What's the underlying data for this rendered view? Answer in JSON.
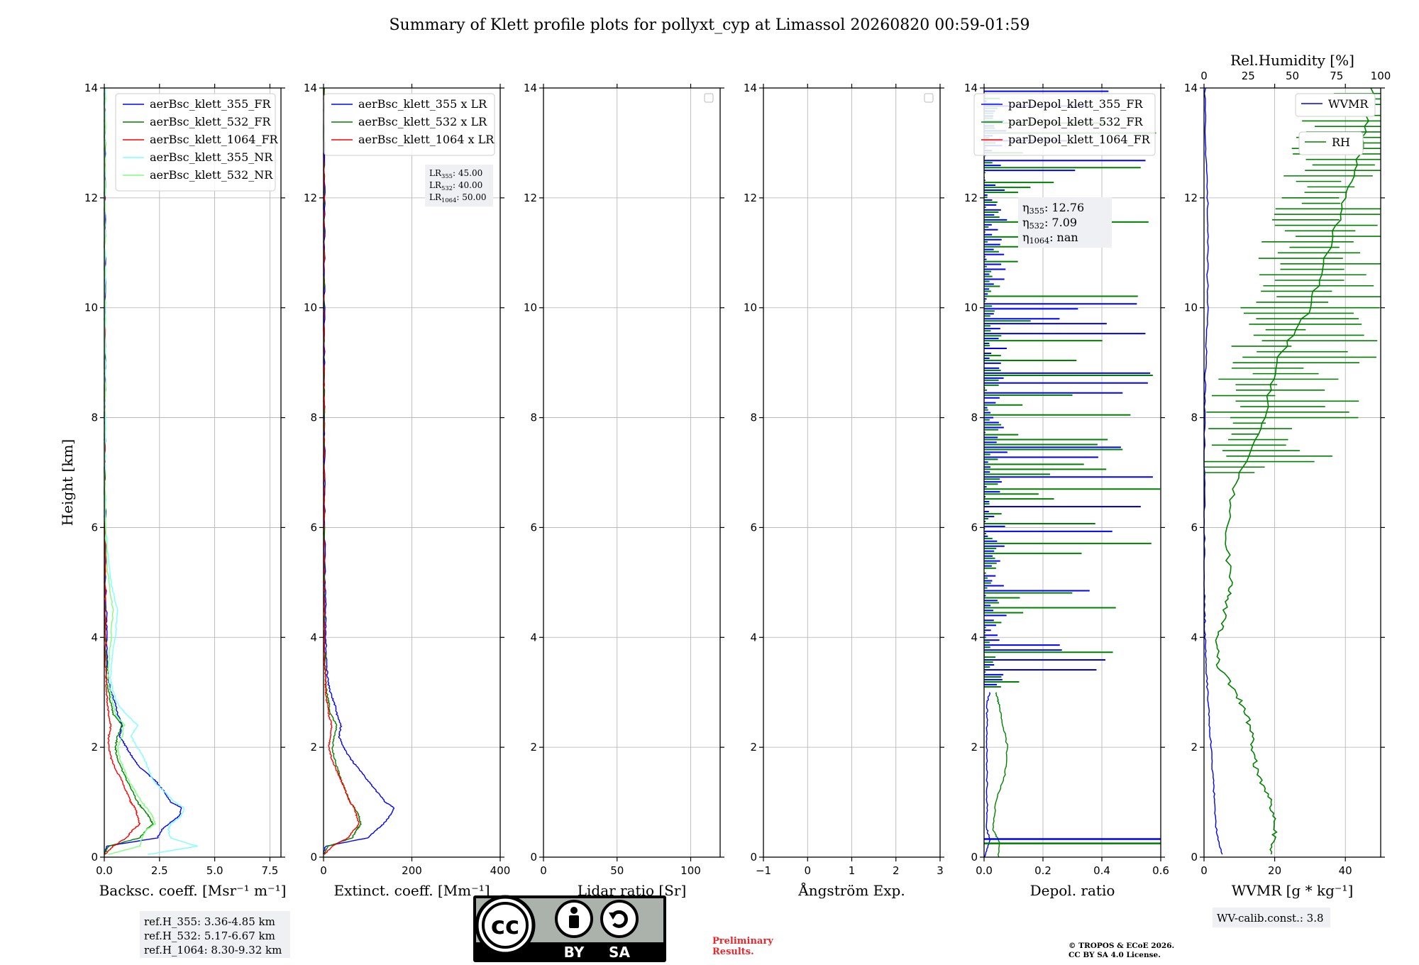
{
  "title": "Summary of Klett profile plots for pollyxt_cyp at Limassol 20260820 00:59-01:59",
  "y_label": "Height [km]",
  "panels": [
    {
      "id": "backscatter",
      "xlabel": "Backsc. coeff. [Msr⁻¹ m⁻¹]",
      "xlim": [
        0,
        8
      ],
      "xticks": [
        0,
        2.5,
        5.0,
        7.5
      ],
      "xtick_labels": [
        "0.0",
        "2.5",
        "5.0",
        "7.5"
      ],
      "legend": [
        "aerBsc_klett_355_FR",
        "aerBsc_klett_532_FR",
        "aerBsc_klett_1064_FR",
        "aerBsc_klett_355_NR",
        "aerBsc_klett_532_NR"
      ],
      "info_box": [
        "ref.H_355: 3.36-4.85 km",
        "ref.H_532: 5.17-6.67 km",
        "ref.H_1064: 8.30-9.32 km"
      ]
    },
    {
      "id": "extinction",
      "xlabel": "Extinct. coeff. [Mm⁻¹]",
      "xlim": [
        0,
        400
      ],
      "xticks": [
        0,
        200,
        400
      ],
      "xtick_labels": [
        "0",
        "200",
        "400"
      ],
      "legend": [
        "aerBsc_klett_355 x LR",
        "aerBsc_klett_532 x LR",
        "aerBsc_klett_1064 x LR"
      ],
      "lr_box": [
        {
          "label": "LR",
          "sub": "355",
          "value": ": 45.00"
        },
        {
          "label": "LR",
          "sub": "532",
          "value": ": 40.00"
        },
        {
          "label": "LR",
          "sub": "1064",
          "value": ": 50.00"
        }
      ]
    },
    {
      "id": "lidar_ratio",
      "xlabel": "Lidar ratio [Sr]",
      "xlim": [
        0,
        120
      ],
      "xticks": [
        0,
        50,
        100
      ],
      "xtick_labels": [
        "0",
        "50",
        "100"
      ]
    },
    {
      "id": "angstrom",
      "xlabel": "Ångström Exp.",
      "xlim": [
        -1,
        3
      ],
      "xticks": [
        -1,
        0,
        1,
        2,
        3
      ],
      "xtick_labels": [
        "−1",
        "0",
        "1",
        "2",
        "3"
      ]
    },
    {
      "id": "depol",
      "xlabel": "Depol. ratio",
      "xlim": [
        0,
        0.6
      ],
      "xticks": [
        0,
        0.2,
        0.4,
        0.6
      ],
      "xtick_labels": [
        "0.0",
        "0.2",
        "0.4",
        "0.6"
      ],
      "legend": [
        "parDepol_klett_355_FR",
        "parDepol_klett_532_FR",
        "parDepol_klett_1064_FR"
      ],
      "eta_box": [
        {
          "label": "η",
          "sub": "355",
          "value": ": 12.76"
        },
        {
          "label": "η",
          "sub": "532",
          "value": ": 7.09"
        },
        {
          "label": "η",
          "sub": "1064",
          "value": ": nan"
        }
      ]
    },
    {
      "id": "wvmr",
      "xlabel": "WVMR [g * kg⁻¹]",
      "xlim": [
        0,
        50
      ],
      "xticks": [
        0,
        20,
        40
      ],
      "xtick_labels": [
        "0",
        "20",
        "40"
      ],
      "top_xlabel": "Rel.Humidity [%]",
      "top_xlim": [
        0,
        100
      ],
      "top_xticks": [
        0,
        25,
        50,
        75,
        100
      ],
      "top_xtick_labels": [
        "0",
        "25",
        "50",
        "75",
        "100"
      ],
      "legend_wvmr": "WVMR",
      "legend_rh": "RH",
      "calib_box": "WV-calib.const.: 3.8"
    }
  ],
  "y_ticks": [
    0,
    2,
    4,
    6,
    8,
    10,
    12,
    14
  ],
  "y_tick_labels": [
    "0",
    "2",
    "4",
    "6",
    "8",
    "10",
    "12",
    "14"
  ],
  "license_badge": {
    "left": "BY",
    "right": "SA"
  },
  "preliminary": [
    "Preliminary",
    "Results."
  ],
  "copyright": [
    "© TROPOS & ECoE 2026.",
    "CC BY SA 4.0 License."
  ],
  "colors": {
    "c355": "#0000ff",
    "c532": "#008000",
    "c1064": "#ff0000",
    "c355nr": "#7fffff",
    "c532nr": "#7fff7f",
    "grid": "#b0b0b0",
    "box": "#eef0f4",
    "red_text": "#e8262b"
  },
  "chart_data": [
    {
      "type": "line",
      "title": "Summary of Klett profile plots for pollyxt_cyp at Limassol 20260820 00:59-01:59",
      "xlabel": "Backsc. coeff. [Msr⁻¹ m⁻¹]",
      "ylabel": "Height [km]",
      "xlim": [
        0,
        8
      ],
      "ylim": [
        0,
        14
      ],
      "grid": true,
      "legend_position": "top-right",
      "y": [
        0.05,
        0.2,
        0.35,
        0.5,
        0.6,
        0.75,
        0.9,
        1.0,
        1.2,
        1.4,
        1.6,
        1.8,
        2.0,
        2.2,
        2.4,
        2.6,
        2.8,
        3.0,
        3.2,
        3.5,
        4.0,
        4.5,
        5.0,
        6.0,
        7.0,
        8.0,
        9.0,
        10.0,
        11.0,
        12.0,
        13.0,
        14.0
      ],
      "series": [
        {
          "name": "aerBsc_klett_355_FR",
          "values": [
            0.0,
            0.1,
            2.4,
            2.6,
            2.9,
            3.4,
            3.5,
            3.0,
            2.7,
            2.3,
            1.7,
            1.3,
            1.0,
            0.7,
            0.8,
            0.6,
            0.5,
            0.3,
            0.2,
            0.15,
            0.1,
            0.1,
            0.05,
            0.05,
            0.03,
            0.03,
            0.03,
            0.03,
            0.03,
            0.03,
            0.03,
            0.02
          ]
        },
        {
          "name": "aerBsc_klett_532_FR",
          "values": [
            0.0,
            0.2,
            1.6,
            1.9,
            2.2,
            2.0,
            1.7,
            1.5,
            1.3,
            1.0,
            0.8,
            0.6,
            0.5,
            0.6,
            0.8,
            0.4,
            0.3,
            0.2,
            0.1,
            0.1,
            0.05,
            0.05,
            0.03,
            0.03,
            0.02,
            0.02,
            0.02,
            0.02,
            0.02,
            0.02,
            0.02,
            0.02
          ]
        },
        {
          "name": "aerBsc_klett_1064_FR",
          "values": [
            0.05,
            0.4,
            1.0,
            1.3,
            1.6,
            1.5,
            1.4,
            1.2,
            1.0,
            0.8,
            0.5,
            0.3,
            0.2,
            0.2,
            0.3,
            0.2,
            0.15,
            0.1,
            0.1,
            0.05,
            0.05,
            0.04,
            0.03,
            0.03,
            0.02,
            0.02,
            0.02,
            0.02,
            0.02,
            0.02,
            0.02,
            0.02
          ]
        },
        {
          "name": "aerBsc_klett_355_NR",
          "values": [
            2.0,
            4.2,
            3.0,
            2.9,
            3.0,
            3.5,
            3.6,
            3.2,
            2.7,
            2.2,
            2.0,
            1.8,
            1.5,
            1.2,
            1.5,
            1.0,
            0.6,
            0.4,
            0.3,
            0.3,
            0.5,
            0.6,
            0.3,
            0.05,
            0.03,
            0.03,
            0.03,
            0.03,
            0.03,
            0.03,
            0.03,
            0.03
          ]
        },
        {
          "name": "aerBsc_klett_532_NR",
          "values": [
            0.2,
            1.6,
            1.7,
            1.9,
            2.3,
            2.2,
            1.9,
            1.7,
            1.4,
            1.1,
            0.9,
            0.7,
            0.6,
            0.8,
            0.9,
            0.5,
            0.4,
            0.3,
            0.2,
            0.2,
            0.3,
            0.4,
            0.2,
            0.03,
            0.02,
            0.02,
            0.02,
            0.02,
            0.02,
            0.02,
            0.02,
            0.02
          ]
        }
      ]
    },
    {
      "type": "line",
      "xlabel": "Extinct. coeff. [Mm⁻¹]",
      "xlim": [
        0,
        400
      ],
      "ylim": [
        0,
        14
      ],
      "grid": true,
      "legend_position": "top-right",
      "y": [
        0.05,
        0.2,
        0.35,
        0.5,
        0.6,
        0.75,
        0.9,
        1.0,
        1.2,
        1.4,
        1.6,
        1.8,
        2.0,
        2.2,
        2.4,
        2.6,
        2.8,
        3.0,
        3.2,
        3.5,
        4.0,
        4.5,
        5.0,
        6.0,
        7.0,
        8.0,
        9.0,
        10.0,
        11.0,
        12.0,
        13.0,
        14.0
      ],
      "series": [
        {
          "name": "aerBsc_klett_355 x LR",
          "values": [
            0,
            5,
            100,
            120,
            135,
            150,
            160,
            140,
            120,
            100,
            80,
            60,
            45,
            35,
            40,
            30,
            25,
            15,
            10,
            7,
            5,
            5,
            3,
            3,
            2,
            2,
            2,
            2,
            2,
            2,
            2,
            1
          ]
        },
        {
          "name": "aerBsc_klett_532 x LR",
          "values": [
            0,
            10,
            65,
            75,
            85,
            80,
            70,
            60,
            50,
            40,
            32,
            25,
            20,
            25,
            30,
            16,
            12,
            8,
            5,
            4,
            2,
            2,
            1,
            1,
            1,
            1,
            1,
            1,
            1,
            1,
            1,
            1
          ]
        },
        {
          "name": "aerBsc_klett_1064 x LR",
          "values": [
            2,
            20,
            55,
            70,
            80,
            75,
            70,
            60,
            50,
            40,
            28,
            18,
            12,
            15,
            18,
            12,
            8,
            5,
            4,
            3,
            2,
            2,
            1,
            1,
            1,
            1,
            1,
            1,
            1,
            1,
            1,
            1
          ]
        }
      ]
    },
    {
      "type": "line",
      "xlabel": "Lidar ratio [Sr]",
      "xlim": [
        0,
        120
      ],
      "ylim": [
        0,
        14
      ],
      "grid": true,
      "series": []
    },
    {
      "type": "line",
      "xlabel": "Ångström Exp.",
      "xlim": [
        -1,
        3
      ],
      "ylim": [
        0,
        14
      ],
      "grid": true,
      "series": []
    },
    {
      "type": "line",
      "xlabel": "Depol. ratio",
      "xlim": [
        0,
        0.6
      ],
      "ylim": [
        0,
        14
      ],
      "grid": true,
      "legend_position": "top-right",
      "y": [
        0.0,
        0.3,
        0.5,
        1.0,
        1.5,
        2.0,
        2.5,
        2.8,
        3.0
      ],
      "series": [
        {
          "name": "parDepol_klett_355_FR",
          "values": [
            0.0,
            0.02,
            0.01,
            0.01,
            0.01,
            0.01,
            0.01,
            0.01,
            0.02
          ]
        },
        {
          "name": "parDepol_klett_532_FR",
          "values": [
            0.05,
            0.05,
            0.03,
            0.04,
            0.07,
            0.08,
            0.06,
            0.05,
            0.04
          ]
        },
        {
          "name": "parDepol_klett_1064_FR",
          "values": []
        }
      ],
      "annotations": [
        "η355: 12.76",
        "η532: 7.09",
        "η1064: nan"
      ]
    },
    {
      "type": "line",
      "xlabel": "WVMR [g * kg⁻¹]",
      "x2label": "Rel.Humidity [%]",
      "xlim": [
        0,
        50
      ],
      "x2lim": [
        0,
        100
      ],
      "ylim": [
        0,
        14
      ],
      "grid": true,
      "y": [
        0.05,
        0.5,
        1.0,
        1.5,
        2.0,
        2.5,
        3.0,
        3.5,
        4.0,
        4.5,
        5.0,
        6.0,
        7.0,
        8.0,
        9.0,
        10.0,
        11.0,
        12.0,
        13.0,
        14.0
      ],
      "series": [
        {
          "name": "WVMR",
          "values": [
            5.0,
            3.5,
            3.0,
            2.5,
            2.0,
            1.5,
            1.0,
            0.6,
            0.3,
            0.2,
            0.1,
            0.1,
            0.1,
            0.1,
            0.5,
            1.0,
            1.0,
            1.0,
            0.5,
            0.3
          ]
        },
        {
          "name": "RH",
          "values": [
            38,
            40,
            38,
            30,
            28,
            25,
            18,
            8,
            8,
            12,
            15,
            12,
            20,
            35,
            40,
            60,
            70,
            80,
            90,
            95
          ]
        }
      ]
    }
  ]
}
